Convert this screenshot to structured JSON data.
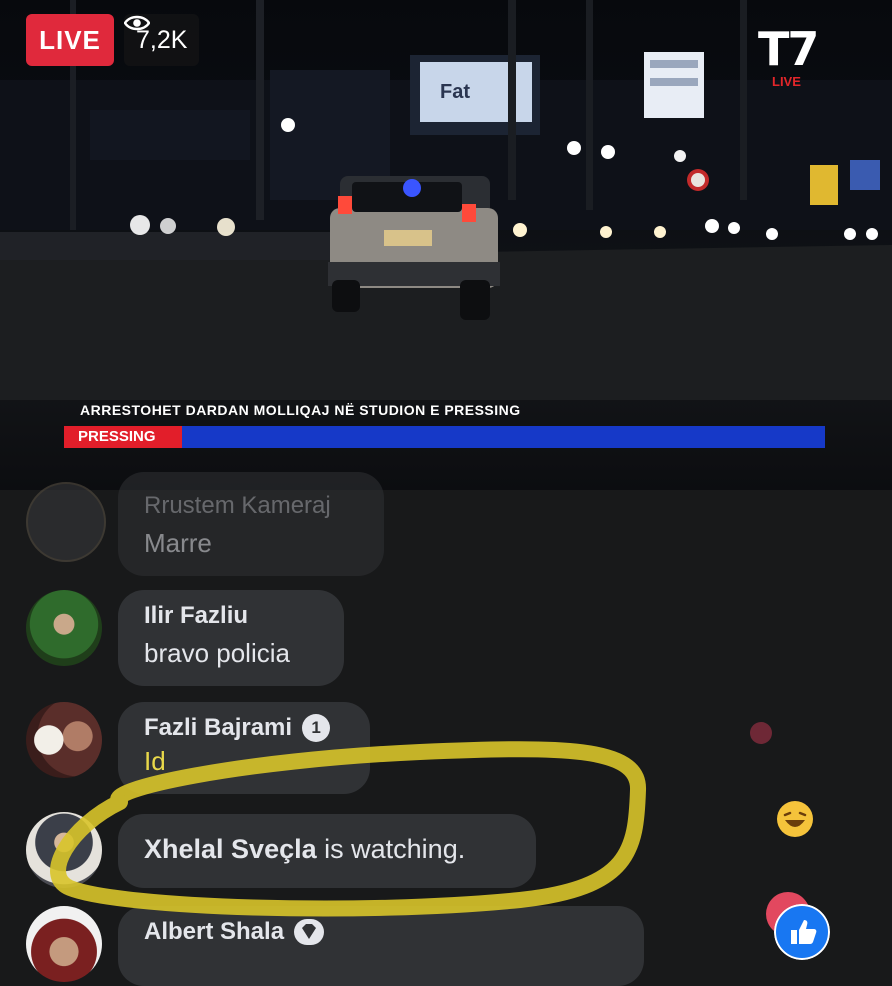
{
  "stream": {
    "live_label": "LIVE",
    "viewer_count": "7,2K",
    "channel_logo": "T7",
    "channel_sub": "LIVE",
    "headline": "ARRESTOHET DARDAN MOLLIQAJ NË STUDION E PRESSING",
    "ticker_label": "PRESSING",
    "billboard_text": "Fat",
    "colors": {
      "live_red": "#e0293c",
      "ticker_blue": "#1639c8",
      "ticker_red": "#e21e2a"
    }
  },
  "comments": [
    {
      "author": "Rrustem Kameraj",
      "text": "Marre"
    },
    {
      "author": "Ilir Fazliu",
      "text": "bravo policia"
    },
    {
      "author": "Fazli Bajrami",
      "badge": "1",
      "text": "Id"
    },
    {
      "author": "Xhelal Sveçla",
      "status": "is watching."
    },
    {
      "author": "Albert Shala",
      "badge": "diamond-icon"
    }
  ],
  "reactions": [
    "love-icon",
    "haha-icon",
    "like-icon"
  ]
}
